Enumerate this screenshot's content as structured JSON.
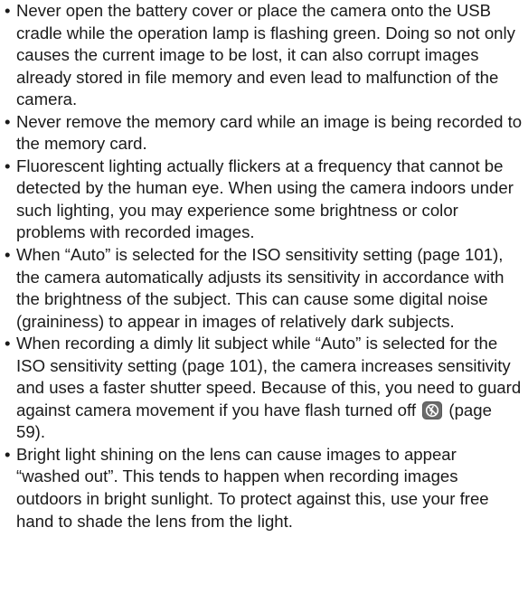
{
  "notes": [
    {
      "bullet": "•",
      "text": "Never open the battery cover or place the camera onto the USB cradle while the operation lamp is flashing green. Doing so not only causes the current image to be lost, it can also corrupt images already stored in file memory and even lead to malfunction of the camera."
    },
    {
      "bullet": "•",
      "text": "Never remove the memory card while an image is being recorded to the memory card."
    },
    {
      "bullet": "•",
      "text": "Fluorescent lighting actually flickers at a frequency that cannot be detected by the human eye. When using the camera indoors under such lighting, you may experience some brightness or color problems with recorded images."
    },
    {
      "bullet": "•",
      "text": "When “Auto” is selected for the ISO sensitivity setting (page 101), the camera automatically adjusts its sensitivity in accordance with the brightness of the subject. This can cause some digital noise (graininess) to appear in images of relatively dark subjects."
    },
    {
      "bullet": "•",
      "text_before_icon": "When recording a dimly lit subject while “Auto” is selected for the ISO sensitivity setting (page 101), the camera increases sensitivity and uses a faster shutter speed. Because of this, you need to guard against camera movement if you have flash turned off",
      "icon": "flash-off-icon",
      "text_after_icon": "(page 59)."
    },
    {
      "bullet": "•",
      "text": "Bright light shining on the lens can cause images to appear “washed out”. This tends to happen when recording images outdoors in bright sunlight. To protect against this, use your free hand to shade the lens from the light."
    }
  ]
}
